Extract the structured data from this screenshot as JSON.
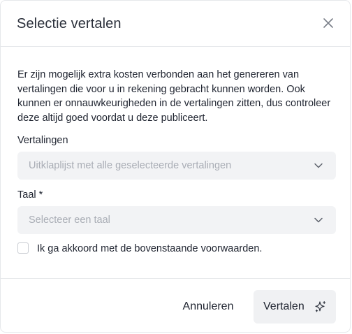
{
  "dialog": {
    "title": "Selectie vertalen",
    "description": "Er zijn mogelijk extra kosten verbonden aan het genereren van vertalingen die voor u in rekening gebracht kunnen worden. Ook kunnen er onnauwkeurigheden in de vertalingen zitten, dus controleer deze altijd goed voordat u deze publiceert.",
    "translations_field": {
      "label": "Vertalingen",
      "placeholder": "Uitklaplijst met alle geselecteerde vertalingen"
    },
    "language_field": {
      "label": "Taal *",
      "placeholder": "Selecteer een taal"
    },
    "agreement": {
      "label": "Ik ga akkoord met de bovenstaande voorwaarden.",
      "checked": false
    },
    "buttons": {
      "cancel": "Annuleren",
      "translate": "Vertalen"
    },
    "icons": {
      "close": "close-icon",
      "chevron": "chevron-down-icon",
      "sparkle": "sparkle-icon"
    }
  }
}
